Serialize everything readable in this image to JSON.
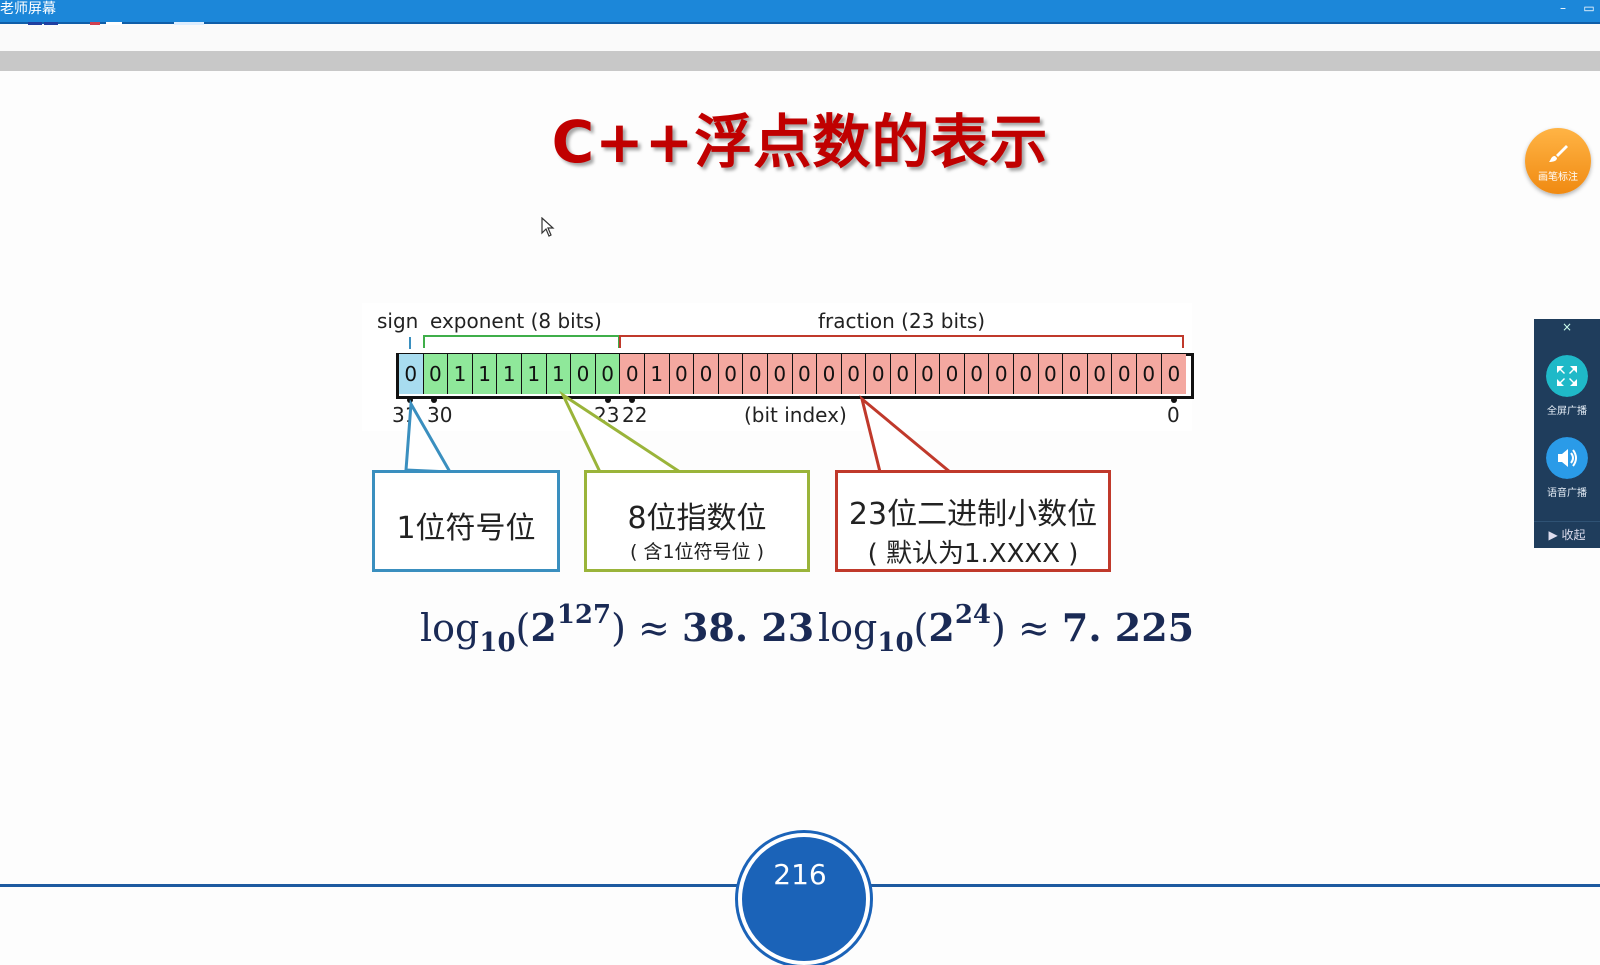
{
  "window": {
    "title": "老师屏幕",
    "minimize_icon": "minimize-icon",
    "restore_icon": "restore-icon"
  },
  "slide": {
    "title": "C++浮点数的表示",
    "diagram": {
      "header_sign": "sign",
      "header_exponent": "exponent (8 bits)",
      "header_fraction": "fraction (23 bits)",
      "bits": [
        "0",
        "0",
        "1",
        "1",
        "1",
        "1",
        "1",
        "0",
        "0",
        "0",
        "1",
        "0",
        "0",
        "0",
        "0",
        "0",
        "0",
        "0",
        "0",
        "0",
        "0",
        "0",
        "0",
        "0",
        "0",
        "0",
        "0",
        "0",
        "0",
        "0",
        "0",
        "0"
      ],
      "index_31": "31",
      "index_30": "30",
      "index_23": "23",
      "index_22": "22",
      "index_0": "0",
      "index_caption": "(bit index)",
      "colors": {
        "sign": "#a8dcef",
        "exponent": "#8fe89a",
        "fraction": "#f4a8a0"
      }
    },
    "callouts": {
      "sign": {
        "main": "1位符号位",
        "color": "#3a8fbf"
      },
      "exponent": {
        "main": "8位指数位",
        "sub": "( 含1位符号位 )",
        "color": "#9ab43a"
      },
      "fraction": {
        "main": "23位二进制小数位",
        "sub": "( 默认为1.XXXX )",
        "color": "#c0392b"
      }
    },
    "formula_left": {
      "log": "log",
      "base": "10",
      "open": "(",
      "two": "2",
      "exp": "127",
      "close": ")",
      "approx": "≈",
      "value": "38. 23"
    },
    "formula_right": {
      "log": "log",
      "base": "10",
      "open": "(",
      "two": "2",
      "exp": "24",
      "close": ")",
      "approx": "≈",
      "value": "7. 225"
    },
    "page_number": "216"
  },
  "tools": {
    "pen_label": "画笔标注",
    "pen_icon": "brush-icon",
    "panel": {
      "close": "×",
      "fullscreen_label": "全屏广播",
      "fullscreen_icon": "expand-icon",
      "voice_label": "语音广播",
      "voice_icon": "speaker-icon",
      "collapse_label": "▶  收起"
    }
  }
}
